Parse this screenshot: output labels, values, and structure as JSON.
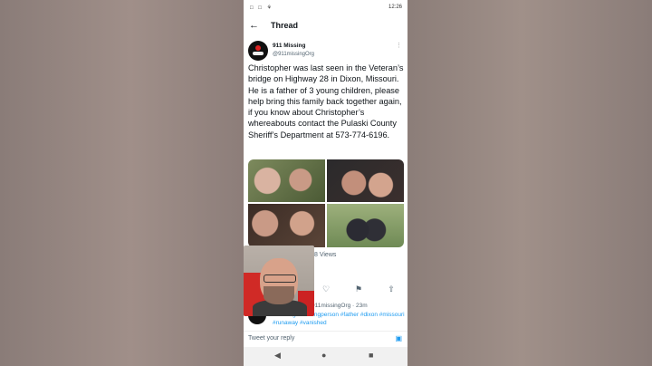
{
  "status_bar": {
    "left_icons": "□ □ ⚘",
    "time": "12:26"
  },
  "app_bar": {
    "back_glyph": "←",
    "title": "Thread"
  },
  "tweet": {
    "author_name": "911 Missing",
    "author_handle": "@911missingOrg",
    "more_glyph": "⋮",
    "text": "Christopher was last seen in the Veteran’s bridge on Highway 28 in Dixon, Missouri. He is a father of 3 young children, please help bring this family back together again, if you know about Christopher’s whereabouts contact the Pulaski County Sheriff’s Department at 573-774-6196.",
    "views": "8 Views"
  },
  "actions": {
    "reply": "✉",
    "retweet": "⇄",
    "like": "♡",
    "bookmark": "⚑",
    "share": "⇧"
  },
  "reply": {
    "header": "911missingOrg · 23m",
    "tags": "#missing #missingperson #father #dixon #missouri #runaway #vanished"
  },
  "reply_bar": {
    "placeholder": "Tweet your reply",
    "camera_glyph": "▣"
  },
  "nav_bar": {
    "back": "◀",
    "home": "●",
    "recents": "■"
  },
  "colors": {
    "accent": "#1d9bf0",
    "text": "#0f1419",
    "muted": "#536471"
  }
}
